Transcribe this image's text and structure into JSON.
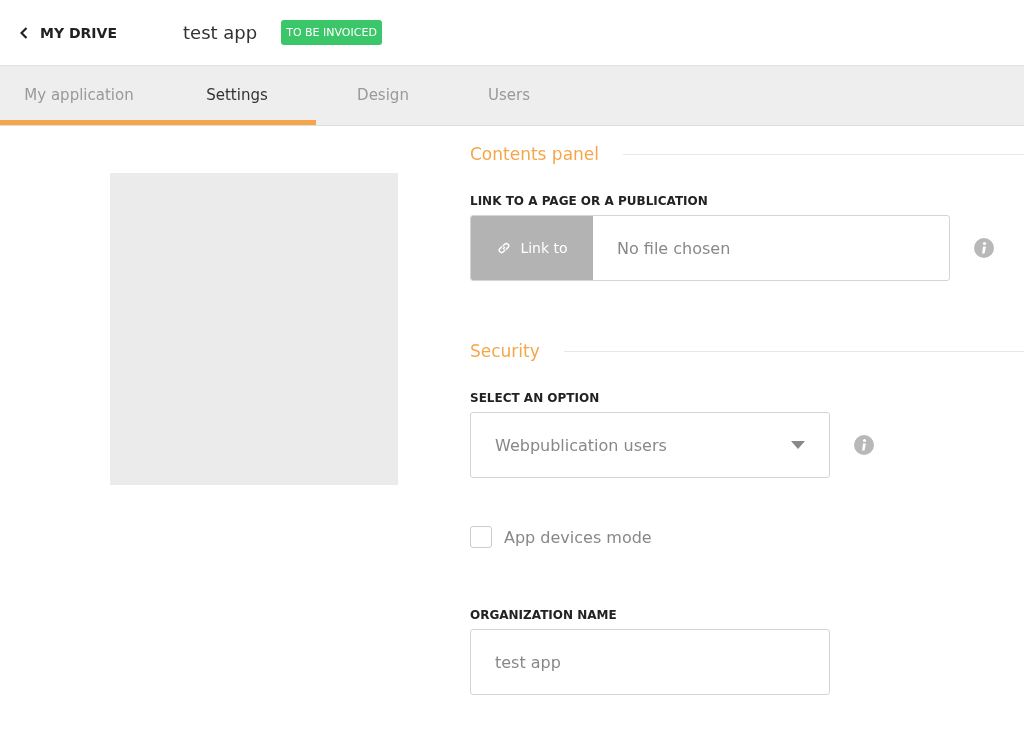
{
  "header": {
    "back_label": "MY DRIVE",
    "title": "test app",
    "status_badge": "TO BE INVOICED"
  },
  "tabs": [
    {
      "label": "My application",
      "selected": false
    },
    {
      "label": "Settings",
      "selected": true
    },
    {
      "label": "Design",
      "selected": false
    },
    {
      "label": "Users",
      "selected": false
    }
  ],
  "sections": [
    {
      "title": "Contents panel",
      "fields": [
        {
          "kind": "file_link",
          "label": "LINK TO A PAGE OR A PUBLICATION",
          "button": "Link to",
          "value": "No file chosen",
          "info": true
        }
      ]
    },
    {
      "title": "Security",
      "fields": [
        {
          "kind": "select",
          "label": "SELECT AN OPTION",
          "value": "Webpublication users",
          "info": true
        },
        {
          "kind": "checkbox",
          "label": "App devices mode",
          "checked": false
        },
        {
          "kind": "text",
          "label": "ORGANIZATION NAME",
          "value": "test app"
        }
      ]
    }
  ]
}
